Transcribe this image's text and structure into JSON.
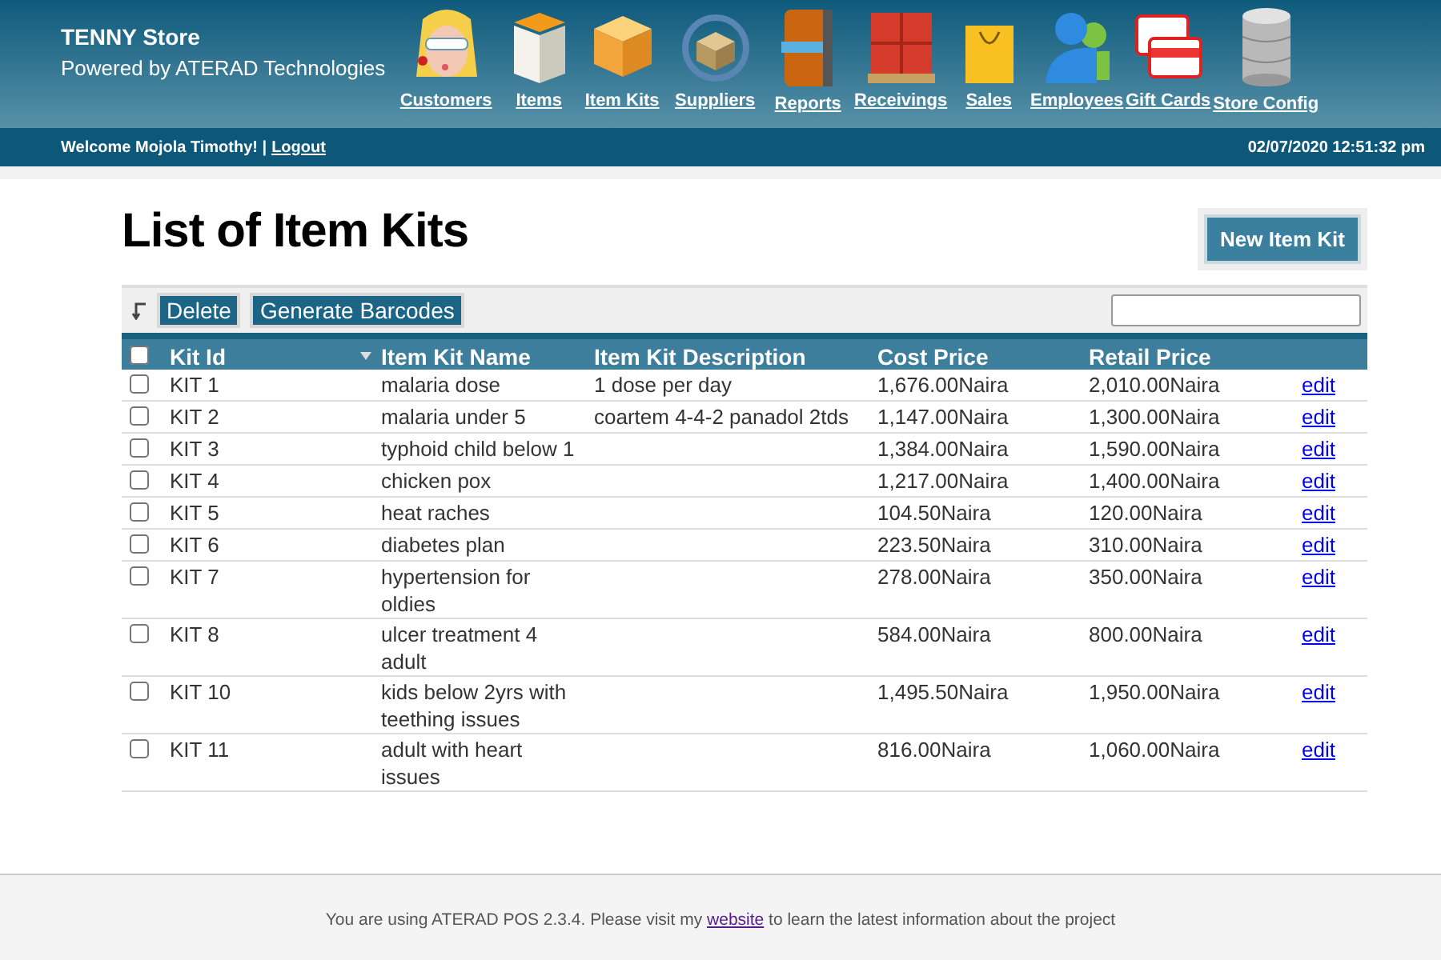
{
  "header": {
    "store_name": "TENNY Store",
    "powered_by": "Powered by ATERAD Technologies",
    "nav": [
      {
        "label": "Customers"
      },
      {
        "label": "Items"
      },
      {
        "label": "Item Kits"
      },
      {
        "label": "Suppliers"
      },
      {
        "label": "Reports"
      },
      {
        "label": "Receivings"
      },
      {
        "label": "Sales"
      },
      {
        "label": "Employees"
      },
      {
        "label": "Gift Cards"
      },
      {
        "label": "Store Config"
      }
    ]
  },
  "user_bar": {
    "welcome": "Welcome Mojola Timothy! |",
    "logout": "Logout",
    "datetime": "02/07/2020 12:51:32 pm"
  },
  "page_title": "List of Item Kits",
  "new_button": "New Item Kit",
  "actions": [
    "Delete",
    "Generate Barcodes"
  ],
  "table": {
    "select_all_checked": false,
    "columns": [
      "Kit Id",
      "Item Kit Name",
      "Item Kit Description",
      "Cost Price",
      "Retail Price"
    ],
    "rows": [
      {
        "id": "KIT 1",
        "name": "malaria dose",
        "description": "1 dose per day",
        "cost": "1,676.00Naira",
        "retail": "2,010.00Naira",
        "action": "edit",
        "checked": false
      },
      {
        "id": "KIT 2",
        "name": "malaria under 5",
        "description": "coartem 4-4-2 panadol 2tds",
        "cost": "1,147.00Naira",
        "retail": "1,300.00Naira",
        "action": "edit",
        "checked": false
      },
      {
        "id": "KIT 3",
        "name": "typhoid child below 1",
        "cost": "1,384.00Naira",
        "retail": "1,590.00Naira",
        "action": "edit",
        "checked": false
      },
      {
        "id": "KIT 4",
        "name": "chicken pox",
        "cost": "1,217.00Naira",
        "retail": "1,400.00Naira",
        "action": "edit",
        "checked": false
      },
      {
        "id": "KIT 5",
        "name": "heat raches",
        "cost": "104.50Naira",
        "retail": "120.00Naira",
        "action": "edit",
        "checked": false
      },
      {
        "id": "KIT 6",
        "name": "diabetes plan",
        "cost": "223.50Naira",
        "retail": "310.00Naira",
        "action": "edit",
        "checked": false
      },
      {
        "id": "KIT 7",
        "name": "hypertension for oldies",
        "cost": "278.00Naira",
        "retail": "350.00Naira",
        "action": "edit",
        "checked": false
      },
      {
        "id": "KIT 8",
        "name": "ulcer treatment 4 adult",
        "cost": "584.00Naira",
        "retail": "800.00Naira",
        "action": "edit",
        "checked": false
      },
      {
        "id": "KIT 10",
        "name": "kids below 2yrs with teething issues",
        "cost": "1,495.50Naira",
        "retail": "1,950.00Naira",
        "action": "edit",
        "checked": false
      },
      {
        "id": "KIT 11",
        "name": "adult with heart issues",
        "cost": "816.00Naira",
        "retail": "1,060.00Naira",
        "action": "edit",
        "checked": false
      }
    ]
  },
  "footer": {
    "before": "You are using ATERAD POS 2.3.4. Please visit my",
    "link": "website",
    "after": "to learn the latest information about the project"
  }
}
